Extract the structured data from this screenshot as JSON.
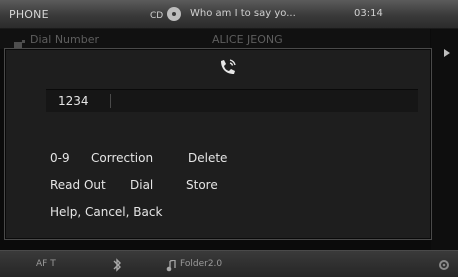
{
  "status_bar": {
    "mode": "PHONE",
    "media_track": "Who am I to say yo...",
    "clock": "03:14"
  },
  "background_list": {
    "item_label": "Dial Number",
    "contact": "ALICE JEONG"
  },
  "dialog": {
    "number_value": "1234",
    "commands": {
      "row1": [
        "0-9",
        "Correction",
        "Delete"
      ],
      "row2": [
        "Read Out",
        "Dial",
        "Store"
      ],
      "row3": [
        "Help, Cancel, Back"
      ]
    }
  },
  "bottom_bar": {
    "station": "AF T",
    "folder": "Folder2.0"
  },
  "icons": {
    "media": "cd-icon",
    "phone": "phone-handset-icon",
    "bluetooth": "bluetooth-icon",
    "music": "music-note-icon",
    "settings": "gear-icon"
  }
}
